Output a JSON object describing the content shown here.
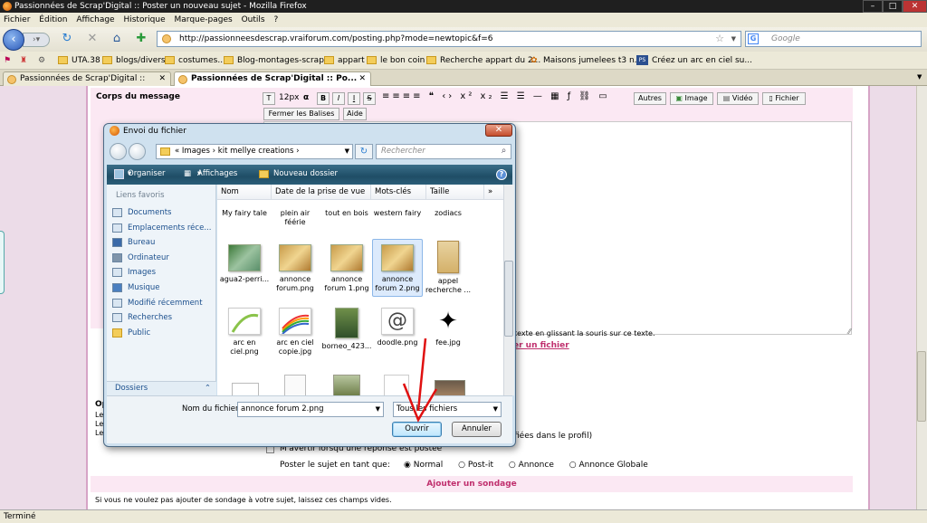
{
  "browser": {
    "title": "Passionnées de Scrap'Digital :: Poster un nouveau sujet - Mozilla Firefox",
    "menu": [
      "Fichier",
      "Édition",
      "Affichage",
      "Historique",
      "Marque-pages",
      "Outils",
      "?"
    ],
    "url": "http://passionneesdescrap.vraiforum.com/posting.php?mode=newtopic&f=6",
    "search_placeholder": "Google",
    "bookmarks": [
      "UTA.38",
      "blogs/divers",
      "costumes...",
      "Blog-montages-scraps",
      "appart",
      "le bon coin",
      "Recherche appart du 2...",
      "Maisons jumelees t3 n...",
      "Créez un arc en ciel su..."
    ],
    "tabs": [
      {
        "label": "Passionnées de Scrap'Digital :: Post...",
        "active": false
      },
      {
        "label": "Passionnées de Scrap'Digital :: Po...",
        "active": true
      }
    ],
    "status": "Terminé"
  },
  "page": {
    "corps_label": "Corps du message",
    "font_size": "12px",
    "editor_buttons": [
      "B",
      "I",
      "S",
      "Autres",
      "Image",
      "Vidéo",
      "Fichier"
    ],
    "fermer_balises": "Fermer les Balises",
    "aide": "Aide",
    "hint_text": "texte en glissant la souris sur ce texte.",
    "upload_link": "er un fichier",
    "profile_text": "fiées dans le profil)",
    "notify_label": "M'avertir lorsqu'une réponse est postée",
    "post_as_label": "Poster le sujet en tant que:",
    "post_types": [
      "Normal",
      "Post-it",
      "Annonce",
      "Annonce Globale"
    ],
    "post_selected": "Normal",
    "sondage_title": "Ajouter un sondage",
    "sondage_hint": "Si vous ne voulez pas ajouter de sondage à votre sujet, laissez ces champs vides."
  },
  "dialog": {
    "title": "Envoi du fichier",
    "path": [
      "Images",
      "kit mellye creations"
    ],
    "search_placeholder": "Rechercher",
    "toolbar": {
      "organize": "Organiser",
      "views": "Affichages",
      "new_folder": "Nouveau dossier"
    },
    "favorites_title": "Liens favoris",
    "favorites": [
      "Documents",
      "Emplacements réce...",
      "Bureau",
      "Ordinateur",
      "Images",
      "Musique",
      "Modifié récemment",
      "Recherches",
      "Public"
    ],
    "folders_label": "Dossiers",
    "columns": [
      "Nom",
      "Date de la prise de vue",
      "Mots-clés",
      "Taille"
    ],
    "files_row1": [
      "My fairy tale",
      "plein air féérie",
      "tout en bois",
      "western fairy",
      "zodiacs"
    ],
    "files_row2": [
      "agua2-perri...",
      "annonce forum.png",
      "annonce forum 1.png",
      "annonce forum 2.png",
      "appel recherche ..."
    ],
    "files_row3": [
      "arc en ciel.png",
      "arc en ciel copie.jpg",
      "borneo_423...",
      "doodle.png",
      "fee.jpg"
    ],
    "selected_file": "annonce forum 2.png",
    "filename_label": "Nom du fichier :",
    "filename_value": "annonce forum 2.png",
    "filetype": "Tous les fichiers",
    "open_button": "Ouvrir",
    "cancel_button": "Annuler"
  },
  "colors": {
    "accent": "#c0306e",
    "arrow": "#e01010"
  }
}
